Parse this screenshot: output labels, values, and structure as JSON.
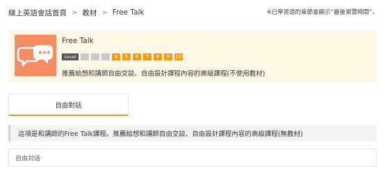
{
  "breadcrumb": {
    "home": "線上英語會話首頁",
    "materials": "教材",
    "current": "Free Talk"
  },
  "notice": "※已學習過的章節會顯示“最後瀏覽時間”。",
  "course": {
    "title": "Free Talk",
    "level_label": "Level",
    "levels": [
      "",
      "",
      "",
      "4",
      "5",
      "6",
      "7",
      "8",
      "9",
      "10"
    ],
    "description": "推薦給想和講師自由交談、自由設計課程內容的高級課程(不使用教材)",
    "icon_color": "#f58d63",
    "active_level_color": "#f39a18"
  },
  "tab": {
    "label": "自由對話",
    "accent": "#f39a18"
  },
  "intro": "這項是和講師的Free Talk課程。推薦給想和講師自由交談、自由設計課程內容的高級課程(無教材)",
  "session": {
    "label": "自由対话"
  }
}
